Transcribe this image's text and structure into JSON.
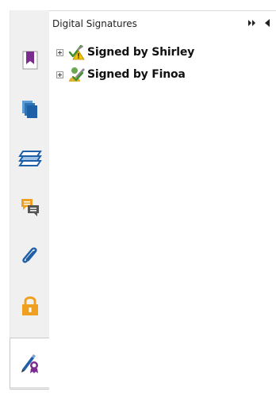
{
  "panel": {
    "title": "Digital Signatures"
  },
  "header_controls": {
    "collapse_icon": "double-chevron-right-icon",
    "pin_icon": "triangle-left-icon"
  },
  "rail": {
    "items": [
      {
        "name": "bookmark",
        "icon": "bookmark-icon",
        "color": "#7b2d8e"
      },
      {
        "name": "pages",
        "icon": "pages-icon",
        "color": "#1e6fbf"
      },
      {
        "name": "layers",
        "icon": "layers-icon",
        "color": "#1e6fbf"
      },
      {
        "name": "comments",
        "icon": "comments-icon",
        "color": "#f0a020"
      },
      {
        "name": "attachments",
        "icon": "paperclip-icon",
        "color": "#1e6fbf"
      },
      {
        "name": "security",
        "icon": "lock-icon",
        "color": "#f0a020"
      },
      {
        "name": "digital-signatures",
        "icon": "signature-pen-icon",
        "color": "#1e6fbf",
        "active": true
      }
    ]
  },
  "signatures": [
    {
      "label": "Signed by Shirley",
      "status_icon": "signature-warning-icon"
    },
    {
      "label": "Signed by Finoa",
      "status_icon": "signature-valid-icon"
    }
  ]
}
